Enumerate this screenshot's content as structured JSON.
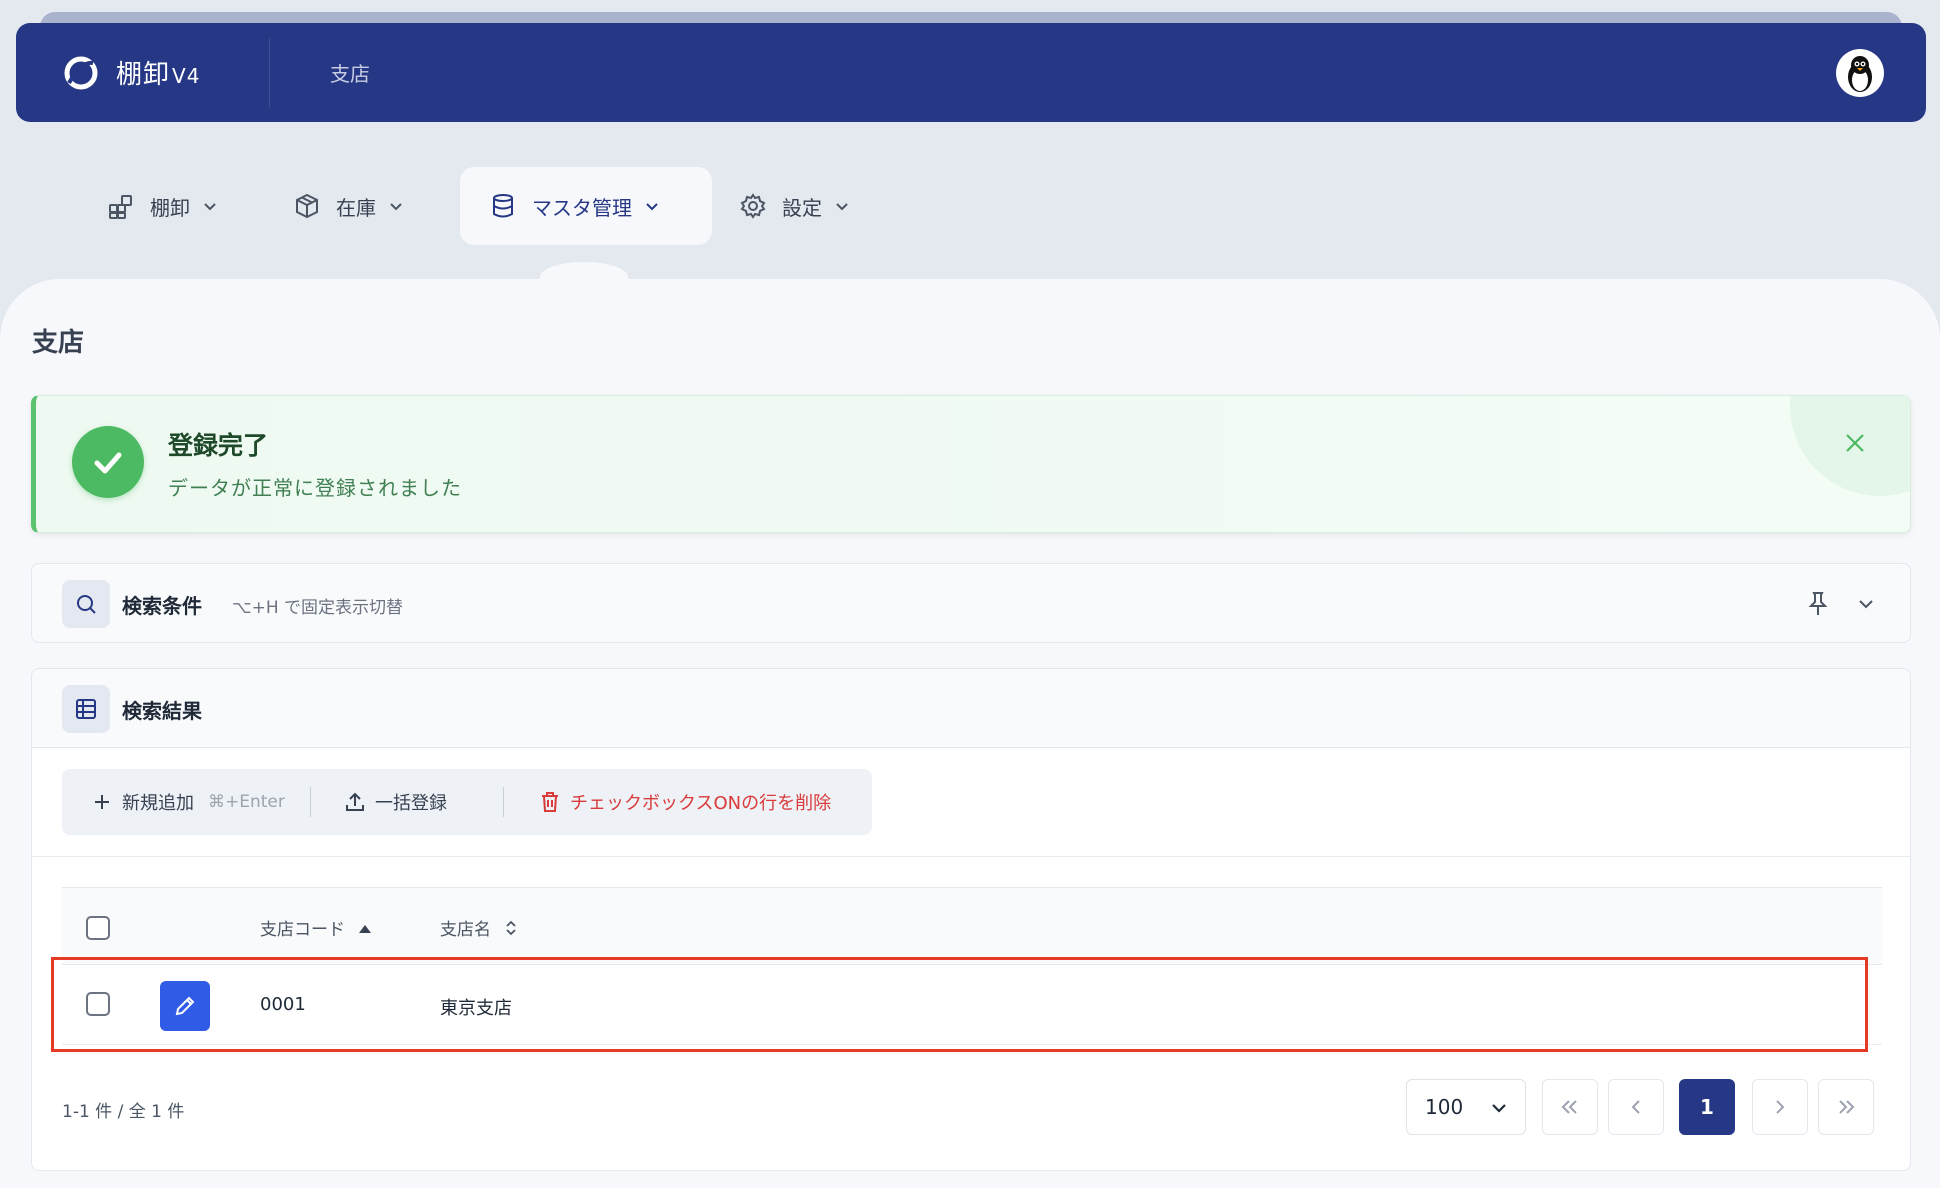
{
  "header": {
    "app_name": "棚卸",
    "app_version": "V4",
    "current_page": "支店"
  },
  "menu": {
    "items": [
      {
        "label": "棚卸",
        "icon": "blocks-icon"
      },
      {
        "label": "在庫",
        "icon": "box-icon"
      },
      {
        "label": "マスタ管理",
        "icon": "database-icon",
        "active": true
      },
      {
        "label": "設定",
        "icon": "gear-icon"
      }
    ]
  },
  "page_title": "支店",
  "alert": {
    "title": "登録完了",
    "message": "データが正常に登録されました",
    "accent_color": "#4cb963"
  },
  "search_panel": {
    "title": "検索条件",
    "hint": "⌥+H で固定表示切替"
  },
  "results_panel": {
    "title": "検索結果",
    "toolbar": {
      "add_label": "新規追加",
      "add_shortcut": "⌘+Enter",
      "bulk_label": "一括登録",
      "delete_label": "チェックボックスONの行を削除"
    },
    "table": {
      "columns": [
        "支店コード",
        "支店名"
      ],
      "rows": [
        {
          "code": "0001",
          "name": "東京支店"
        }
      ]
    },
    "footer": {
      "count_text": "1-1 件 / 全 1 件",
      "per_page": "100",
      "current_page": "1"
    }
  },
  "colors": {
    "header_bg": "#263885",
    "primary": "#2f5be6",
    "danger": "#d93a3a",
    "highlight": "#e53b26"
  }
}
